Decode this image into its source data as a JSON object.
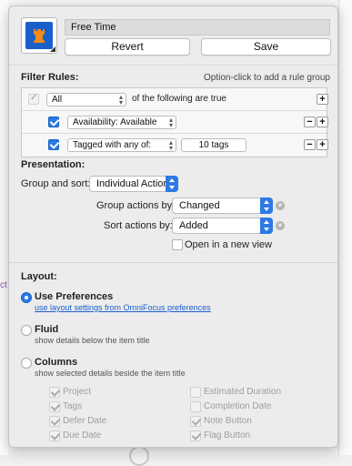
{
  "perspective": {
    "name": "Free Time",
    "icon": "chess-rook-icon",
    "icon_color": "#1a5fc9",
    "icon_glyph_color": "#f08a1c",
    "revert_label": "Revert",
    "save_label": "Save"
  },
  "filter_rules": {
    "title": "Filter Rules:",
    "hint": "Option-click to add a rule group",
    "rows": [
      {
        "checked": true,
        "popup": "All",
        "suffix": "of the following are true"
      },
      {
        "checked": true,
        "popup": "Availability: Available"
      },
      {
        "checked": true,
        "popup": "Tagged with any of:",
        "tags": "10 tags"
      }
    ]
  },
  "presentation": {
    "title": "Presentation:",
    "group_sort_label": "Group and sort:",
    "group_sort_value": "Individual Actions",
    "group_actions_label": "Group actions by:",
    "group_actions_value": "Changed",
    "sort_actions_label": "Sort actions by:",
    "sort_actions_value": "Added",
    "open_new_window_label": "Open in a new view",
    "accent_color": "#2d7ae5"
  },
  "layout": {
    "title": "Layout:",
    "options": [
      {
        "title": "Use Preferences",
        "desc": "use layout settings from OmniFocus preferences",
        "selected": true
      },
      {
        "title": "Fluid",
        "desc": "show details below the item title",
        "selected": false
      },
      {
        "title": "Columns",
        "desc": "show selected details beside the item title",
        "selected": false
      }
    ],
    "columns_left": [
      "Project",
      "Tags",
      "Defer Date",
      "Due Date"
    ],
    "columns_right": [
      "Estimated Duration",
      "Completion Date",
      "Note Button",
      "Flag Button"
    ]
  },
  "background": {
    "side_text": "ct"
  }
}
